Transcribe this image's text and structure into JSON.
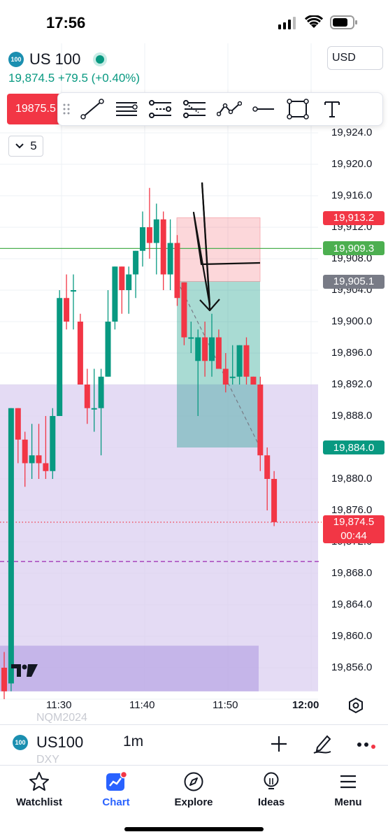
{
  "status_bar": {
    "time": "17:56"
  },
  "header": {
    "symbol_logo": "100",
    "symbol": "US 100",
    "live_indicator_color": "#089981",
    "price_line": "19,874.5 +79.5 (+0.40%)",
    "currency": "USD",
    "sell_price": "19875.5"
  },
  "drawing_toolbar": {
    "tools": [
      "trend-line-icon",
      "horizontal-lines-icon",
      "parallel-channel-icon",
      "fib-retracement-icon",
      "path-icon",
      "horizontal-ray-icon",
      "rectangle-icon",
      "text-icon"
    ]
  },
  "collapse_button": {
    "label": "5"
  },
  "price_axis": {
    "ticks": [
      "19,924.0",
      "19,920.0",
      "19,916.0",
      "19,912.0",
      "19,908.0",
      "19,904.0",
      "19,900.0",
      "19,896.0",
      "19,892.0",
      "19,888.0",
      "19,884.0",
      "19,880.0",
      "19,876.0",
      "19,872.0",
      "19,868.0",
      "19,864.0",
      "19,860.0",
      "19,856.0"
    ],
    "labels": [
      {
        "text": "19,913.2",
        "color": "#f23645"
      },
      {
        "text": "19,909.3",
        "color": "#4caf50"
      },
      {
        "text": "19,905.1",
        "color": "#787b86"
      },
      {
        "text": "19,884.0",
        "color": "#089981"
      },
      {
        "text": "19,874.5",
        "color": "#f23645"
      },
      {
        "text": "00:44",
        "color": "#f23645"
      }
    ]
  },
  "time_axis": {
    "ticks": [
      "11:30",
      "11:40",
      "11:50",
      "12:00"
    ]
  },
  "chart_data": {
    "type": "candlestick",
    "x_unit": "minute",
    "up_color": "#089981",
    "down_color": "#f23645",
    "candles": [
      {
        "o": 19856,
        "h": 19858,
        "l": 19852,
        "c": 19853
      },
      {
        "o": 19854,
        "h": 19889,
        "l": 19853,
        "c": 19889
      },
      {
        "o": 19889,
        "h": 19889,
        "l": 19882,
        "c": 19885
      },
      {
        "o": 19885,
        "h": 19886,
        "l": 19879,
        "c": 19882
      },
      {
        "o": 19882,
        "h": 19887,
        "l": 19880,
        "c": 19883
      },
      {
        "o": 19883,
        "h": 19887,
        "l": 19880,
        "c": 19882
      },
      {
        "o": 19882,
        "h": 19888,
        "l": 19880,
        "c": 19881
      },
      {
        "o": 19881,
        "h": 19889,
        "l": 19880,
        "c": 19888
      },
      {
        "o": 19888,
        "h": 19904,
        "l": 19888,
        "c": 19903
      },
      {
        "o": 19903,
        "h": 19906,
        "l": 19899,
        "c": 19900
      },
      {
        "o": 19904,
        "h": 19906,
        "l": 19899,
        "c": 19904
      },
      {
        "o": 19900,
        "h": 19901,
        "l": 19892,
        "c": 19892
      },
      {
        "o": 19892,
        "h": 19894,
        "l": 19887,
        "c": 19889
      },
      {
        "o": 19889,
        "h": 19894,
        "l": 19886,
        "c": 19889
      },
      {
        "o": 19889,
        "h": 19894,
        "l": 19883,
        "c": 19893
      },
      {
        "o": 19893,
        "h": 19904,
        "l": 19893,
        "c": 19900
      },
      {
        "o": 19900,
        "h": 19907,
        "l": 19899,
        "c": 19907
      },
      {
        "o": 19907,
        "h": 19907,
        "l": 19901,
        "c": 19904
      },
      {
        "o": 19904,
        "h": 19907,
        "l": 19901,
        "c": 19906
      },
      {
        "o": 19906,
        "h": 19909,
        "l": 19903,
        "c": 19909
      },
      {
        "o": 19909,
        "h": 19914,
        "l": 19907,
        "c": 19912
      },
      {
        "o": 19912,
        "h": 19917,
        "l": 19908,
        "c": 19910
      },
      {
        "o": 19910,
        "h": 19915,
        "l": 19906,
        "c": 19913
      },
      {
        "o": 19913,
        "h": 19914,
        "l": 19904,
        "c": 19906
      },
      {
        "o": 19906,
        "h": 19913,
        "l": 19904,
        "c": 19910
      },
      {
        "o": 19910,
        "h": 19911,
        "l": 19902,
        "c": 19903
      },
      {
        "o": 19905,
        "h": 19905,
        "l": 19897,
        "c": 19898
      },
      {
        "o": 19898,
        "h": 19900,
        "l": 19896,
        "c": 19898
      },
      {
        "o": 19895,
        "h": 19899,
        "l": 19888,
        "c": 19898
      },
      {
        "o": 19898,
        "h": 19900,
        "l": 19893,
        "c": 19895
      },
      {
        "o": 19895,
        "h": 19901,
        "l": 19893,
        "c": 19898
      },
      {
        "o": 19898,
        "h": 19899,
        "l": 19894,
        "c": 19894
      },
      {
        "o": 19894,
        "h": 19896,
        "l": 19891,
        "c": 19892
      },
      {
        "o": 19893,
        "h": 19897,
        "l": 19892,
        "c": 19893
      },
      {
        "o": 19893,
        "h": 19897,
        "l": 19892,
        "c": 19897
      },
      {
        "o": 19897,
        "h": 19898,
        "l": 19892,
        "c": 19893
      },
      {
        "o": 19893,
        "h": 19893,
        "l": 19892,
        "c": 19892
      },
      {
        "o": 19892,
        "h": 19893,
        "l": 19881,
        "c": 19883
      },
      {
        "o": 19883,
        "h": 19884,
        "l": 19876,
        "c": 19880
      },
      {
        "o": 19880,
        "h": 19881,
        "l": 19874,
        "c": 19874.5
      }
    ],
    "horizontal_line": 19909.3,
    "current_price": 19874.5,
    "dashed_level": 19869.5,
    "position": {
      "stop": 19913.2,
      "entry": 19905.1,
      "target": 19884.0
    },
    "zones": [
      {
        "from_price": 19892.0,
        "to_price": 19853,
        "color": "#d8ccf0"
      },
      {
        "from_price": 19858.8,
        "to_price": 19853,
        "color": "#bfaee6"
      }
    ],
    "annotation": "hand-drawn-arrow"
  },
  "bottom_bar": {
    "symbol_logo": "100",
    "symbol": "US100",
    "interval": "1m",
    "faded_upper": "NQM2024",
    "faded_lower": "DXY"
  },
  "tab_bar": {
    "tabs": [
      {
        "label": "Watchlist",
        "icon": "star-icon"
      },
      {
        "label": "Chart",
        "icon": "chart-icon",
        "active_color": "#2962ff"
      },
      {
        "label": "Explore",
        "icon": "compass-icon"
      },
      {
        "label": "Ideas",
        "icon": "lightbulb-icon"
      },
      {
        "label": "Menu",
        "icon": "hamburger-icon"
      }
    ]
  }
}
